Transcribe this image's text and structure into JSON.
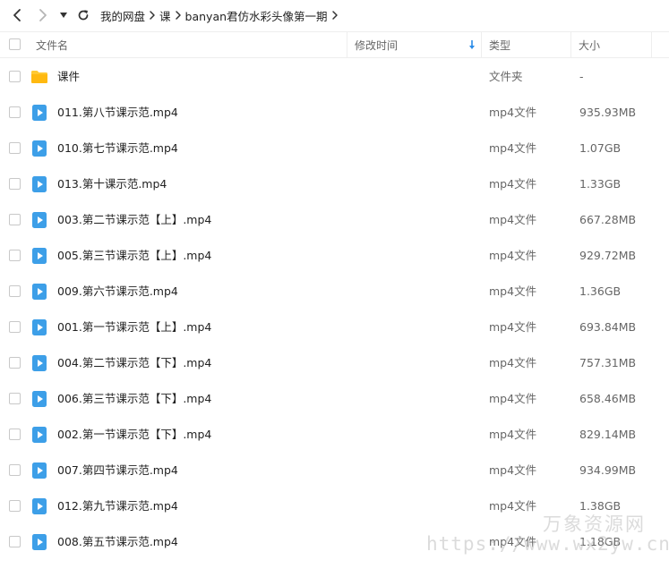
{
  "breadcrumb": [
    "我的网盘",
    "课",
    "banyan君仿水彩头像第一期"
  ],
  "columns": {
    "name": "文件名",
    "modified": "修改时间",
    "type": "类型",
    "size": "大小"
  },
  "files": [
    {
      "name": "课件",
      "type": "文件夹",
      "size": "-",
      "icon": "folder-icon"
    },
    {
      "name": "011.第八节课示范.mp4",
      "type": "mp4文件",
      "size": "935.93MB",
      "icon": "video-file-icon"
    },
    {
      "name": "010.第七节课示范.mp4",
      "type": "mp4文件",
      "size": "1.07GB",
      "icon": "video-file-icon"
    },
    {
      "name": "013.第十课示范.mp4",
      "type": "mp4文件",
      "size": "1.33GB",
      "icon": "video-file-icon"
    },
    {
      "name": "003.第二节课示范【上】.mp4",
      "type": "mp4文件",
      "size": "667.28MB",
      "icon": "video-file-icon"
    },
    {
      "name": "005.第三节课示范【上】.mp4",
      "type": "mp4文件",
      "size": "929.72MB",
      "icon": "video-file-icon"
    },
    {
      "name": "009.第六节课示范.mp4",
      "type": "mp4文件",
      "size": "1.36GB",
      "icon": "video-file-icon"
    },
    {
      "name": "001.第一节课示范【上】.mp4",
      "type": "mp4文件",
      "size": "693.84MB",
      "icon": "video-file-icon"
    },
    {
      "name": "004.第二节课示范【下】.mp4",
      "type": "mp4文件",
      "size": "757.31MB",
      "icon": "video-file-icon"
    },
    {
      "name": "006.第三节课示范【下】.mp4",
      "type": "mp4文件",
      "size": "658.46MB",
      "icon": "video-file-icon"
    },
    {
      "name": "002.第一节课示范【下】.mp4",
      "type": "mp4文件",
      "size": "829.14MB",
      "icon": "video-file-icon"
    },
    {
      "name": "007.第四节课示范.mp4",
      "type": "mp4文件",
      "size": "934.99MB",
      "icon": "video-file-icon"
    },
    {
      "name": "012.第九节课示范.mp4",
      "type": "mp4文件",
      "size": "1.38GB",
      "icon": "video-file-icon"
    },
    {
      "name": "008.第五节课示范.mp4",
      "type": "mp4文件",
      "size": "1.18GB",
      "icon": "video-file-icon"
    }
  ],
  "watermark": {
    "name": "万象资源网",
    "url": "https://www.wx2yw.cn"
  },
  "colors": {
    "folder": "#FFC933",
    "video": "#3D9FE8",
    "sort_arrow": "#2B8CE8"
  }
}
